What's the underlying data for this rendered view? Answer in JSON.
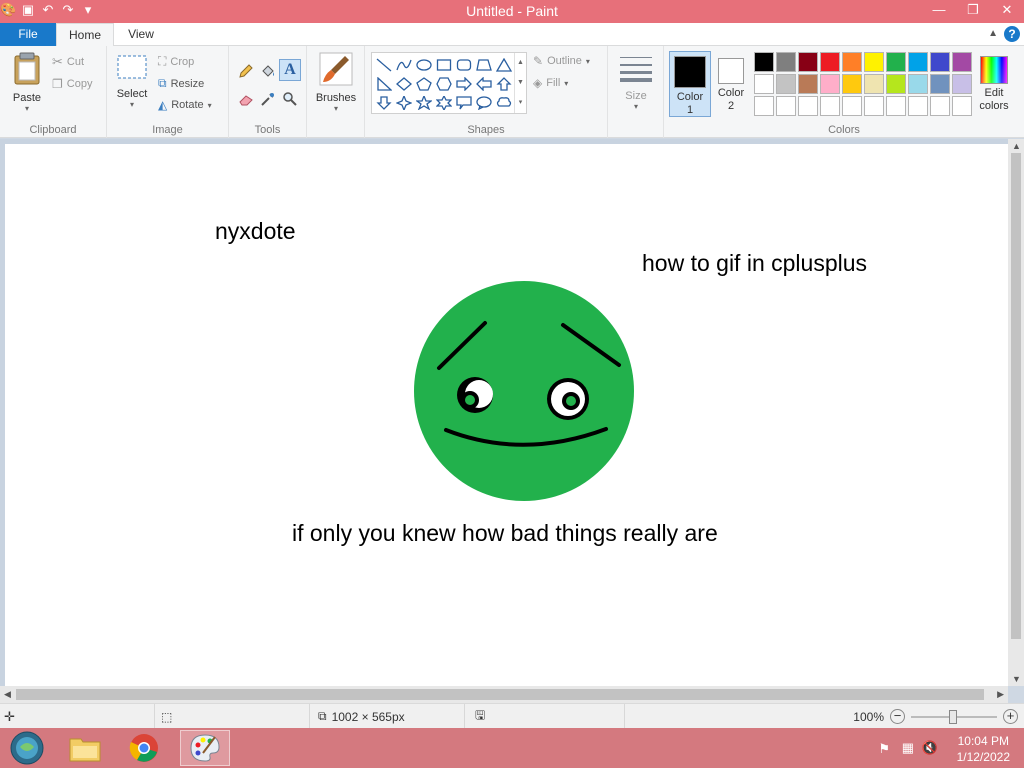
{
  "window": {
    "title": "Untitled - Paint"
  },
  "ribbon": {
    "tabs": [
      {
        "label": "File"
      },
      {
        "label": "Home"
      },
      {
        "label": "View"
      }
    ],
    "clipboard": {
      "label": "Clipboard",
      "paste": "Paste",
      "cut": "Cut",
      "copy": "Copy"
    },
    "image": {
      "label": "Image",
      "select": "Select",
      "crop": "Crop",
      "resize": "Resize",
      "rotate": "Rotate"
    },
    "tools": {
      "label": "Tools"
    },
    "brushes": {
      "label": "Brushes"
    },
    "shapes": {
      "label": "Shapes",
      "outline": "Outline",
      "fill": "Fill"
    },
    "size": {
      "label": "Size"
    },
    "colors": {
      "label": "Colors",
      "color1_label": "Color",
      "color1_num": "1",
      "color2_label": "Color",
      "color2_num": "2",
      "edit_label": "Edit",
      "edit_label2": "colors",
      "color1": "#000000",
      "color2": "#ffffff",
      "palette": [
        "#000000",
        "#7f7f7f",
        "#880015",
        "#ed1c24",
        "#ff7f27",
        "#fff200",
        "#22b14c",
        "#00a2e8",
        "#3f48cc",
        "#a349a4",
        "#ffffff",
        "#c3c3c3",
        "#b97a57",
        "#ffaec9",
        "#ffc90e",
        "#efe4b0",
        "#b5e61d",
        "#99d9ea",
        "#7092be",
        "#c8bfe7",
        "#ffffff",
        "#ffffff",
        "#ffffff",
        "#ffffff",
        "#ffffff",
        "#ffffff",
        "#ffffff",
        "#ffffff",
        "#ffffff",
        "#ffffff"
      ]
    }
  },
  "canvas": {
    "texts": {
      "name": "nyxdote",
      "question": "how to gif in cplusplus",
      "caption": "if only you knew how bad things really are"
    },
    "face_color": "#22b14c"
  },
  "status": {
    "dimensions": "1002 × 565px",
    "zoom": "100%"
  },
  "taskbar": {
    "time": "10:04 PM",
    "date": "1/12/2022"
  }
}
